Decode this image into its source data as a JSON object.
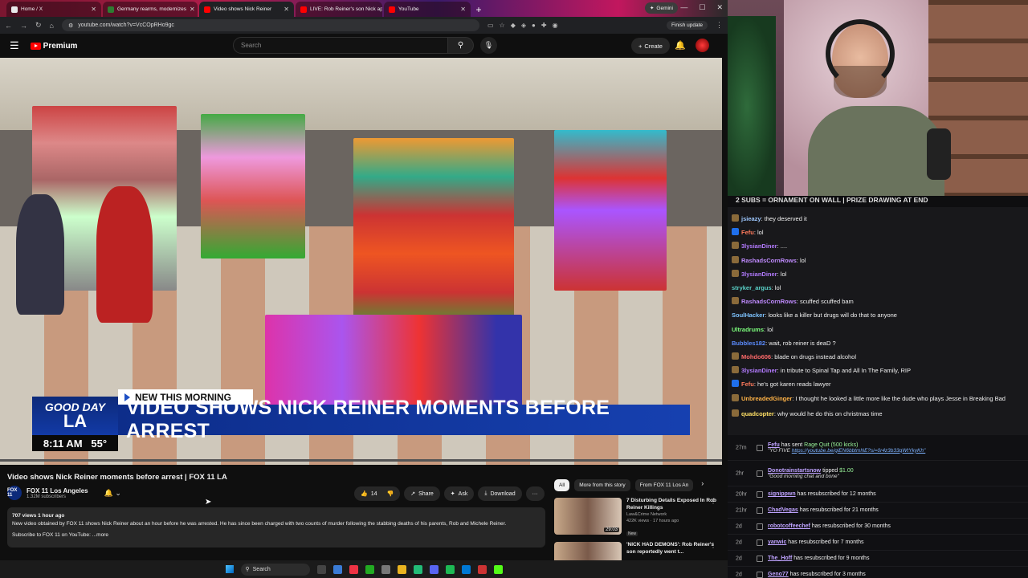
{
  "browser": {
    "tabs": [
      {
        "label": "Home / X",
        "color": "#e7e9ea",
        "active": false
      },
      {
        "label": "Germany rearms, modernizes",
        "color": "#2e7d32",
        "active": false
      },
      {
        "label": "Video shows Nick Reiner",
        "color": "#ff0000",
        "active": true
      },
      {
        "label": "LIVE: Rob Reiner's son Nick ap",
        "color": "#ff0000",
        "active": false
      },
      {
        "label": "YouTube",
        "color": "#ff0000",
        "active": false
      }
    ],
    "gemini_label": "Gemini",
    "url": "youtube.com/watch?v=VcCOpRHo9gc",
    "finish_update_label": "Finish update"
  },
  "youtube": {
    "logo_label": "Premium",
    "search_placeholder": "Search",
    "create_label": "Create"
  },
  "video": {
    "banner": "NEW THIS MORNING",
    "headline": "VIDEO SHOWS NICK REINER MOMENTS BEFORE ARREST",
    "logo_top": "GOOD DAY",
    "logo_bottom": "LA",
    "time": "8:11 AM",
    "temp": "55°"
  },
  "meta": {
    "title": "Video shows Nick Reiner moments before arrest | FOX 11 LA",
    "channel_logo": "FOX 11",
    "channel": "FOX 11 Los Angeles",
    "subs": "1.32M subscribers",
    "likes": "14",
    "share_label": "Share",
    "ask_label": "Ask",
    "download_label": "Download",
    "desc_meta": "707 views  1 hour ago",
    "desc_text": "New video obtained by FOX 11 shows Nick Reiner about an hour before he was arrested. He has since been charged with two counts of murder following the stabbing deaths of his parents, Rob and Michele Reiner.",
    "desc_sub": "Subscribe to FOX 11 on YouTube: ",
    "desc_more": "...more"
  },
  "filters": [
    "All",
    "More from this story",
    "From FOX 11 Los An"
  ],
  "recommendations": [
    {
      "title": "7 Disturbing Details Exposed In Rob Reiner Killings",
      "channel": "Law&Crime Network",
      "stats": "422K views · 17 hours ago",
      "badge": "New",
      "duration": "29:03"
    },
    {
      "title": "'NICK HAD DEMONS': Rob Reiner's son reportedly went t...",
      "channel": "",
      "stats": "",
      "badge": "",
      "duration": ""
    }
  ],
  "taskbar": {
    "search_label": "Search"
  },
  "stream": {
    "marquee": "2 SUBS = ORNAMENT ON WALL | PRIZE DRAWING AT END",
    "chat": [
      {
        "user": "jsieazy",
        "text": "they deserved it",
        "color": "#9ec8ff",
        "badge": ""
      },
      {
        "user": "Fefu",
        "text": "lol",
        "color": "#ff7a5c",
        "badge": "#1f6feb"
      },
      {
        "user": "3lysianDiner",
        "text": "....",
        "color": "#b37bff",
        "badge": ""
      },
      {
        "user": "RashadsCornRows",
        "text": "lol",
        "color": "#c08bff",
        "badge": ""
      },
      {
        "user": "3lysianDiner",
        "text": "lol",
        "color": "#b37bff",
        "badge": ""
      },
      {
        "user": "stryker_argus",
        "text": "lol",
        "color": "#5ad1c8",
        "badge": "none"
      },
      {
        "user": "RashadsCornRows",
        "text": "scuffed scuffed bam",
        "color": "#c08bff",
        "badge": ""
      },
      {
        "user": "SoulHacker",
        "text": "looks like a killer but drugs will do that to anyone",
        "color": "#7ec3ff",
        "badge": "none"
      },
      {
        "user": "Ultradrums",
        "text": "lol",
        "color": "#7cff7c",
        "badge": "none"
      },
      {
        "user": "Bubbles182",
        "text": "wait, rob reiner is deaD ?",
        "color": "#5b8cff",
        "badge": "none"
      },
      {
        "user": "Mohdo606",
        "text": "blade on drugs instead alcohol",
        "color": "#ff6a6a",
        "badge": ""
      },
      {
        "user": "3lysianDiner",
        "text": "in tribute to Spinal Tap and All In The Family, RIP",
        "color": "#b37bff",
        "badge": ""
      },
      {
        "user": "Fefu",
        "text": "he's got karen reads lawyer",
        "color": "#ff7a5c",
        "badge": "#1f6feb"
      },
      {
        "user": "UnbreadedGinger",
        "text": "I thought he looked a little more like the dude who plays Jesse in Breaking Bad",
        "color": "#ffb347",
        "badge": ""
      },
      {
        "user": "quadcopter",
        "text": "why would he do this on christmas time",
        "color": "#ffe066",
        "badge": ""
      }
    ],
    "events": [
      {
        "age": "27m",
        "name": "Fefu",
        "text": " has sent ",
        "highlight": "Rage Quit (500 kicks)",
        "sub": "\"YO FIVE ",
        "link": "https://youtube.be/giEN6bbtmNE?si=0r4z3b33qWtYkyKh\""
      },
      {
        "age": "2hr",
        "name": "Donotrainstartsnow",
        "text": " tipped ",
        "highlight": "$1.00",
        "sub": "\"Good morning chat and bone\"",
        "link": ""
      },
      {
        "age": "20hr",
        "name": "signippwn",
        "text": " has resubscribed for 12 months",
        "highlight": "",
        "sub": "",
        "link": ""
      },
      {
        "age": "21hr",
        "name": "ChadVegas",
        "text": " has resubscribed for 21 months",
        "highlight": "",
        "sub": "",
        "link": ""
      },
      {
        "age": "2d",
        "name": "robotcoffeechef",
        "text": " has resubscribed for 30 months",
        "highlight": "",
        "sub": "",
        "link": ""
      },
      {
        "age": "2d",
        "name": "yanwic",
        "text": " has resubscribed for 7 months",
        "highlight": "",
        "sub": "",
        "link": ""
      },
      {
        "age": "2d",
        "name": "The_Hoff",
        "text": " has resubscribed for 9 months",
        "highlight": "",
        "sub": "",
        "link": ""
      },
      {
        "age": "2d",
        "name": "Geno77",
        "text": " has resubscribed for 3 months",
        "highlight": "",
        "sub": "",
        "link": ""
      }
    ]
  }
}
